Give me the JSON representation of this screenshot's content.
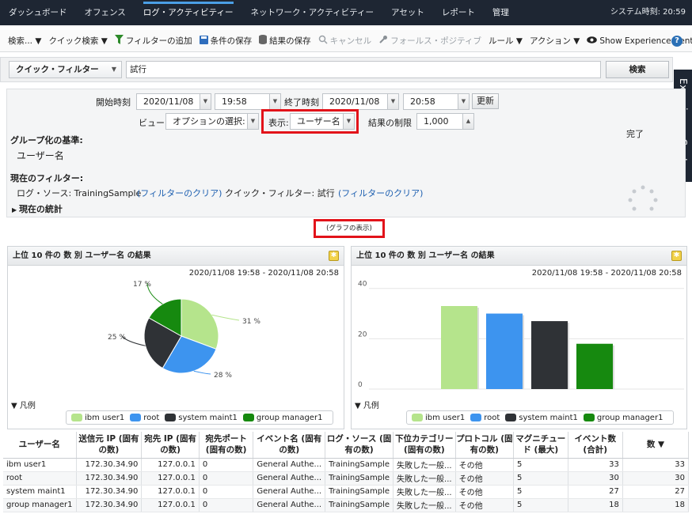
{
  "nav": {
    "items": [
      "ダッシュボード",
      "オフェンス",
      "ログ・アクティビティー",
      "ネットワーク・アクティビティー",
      "アセット",
      "レポート",
      "管理"
    ],
    "active_index": 2,
    "system_time": "システム時刻: 20:59"
  },
  "toolbar": {
    "search": "検索... ▼",
    "quick_search": "クイック検索 ▼",
    "add_filter": "フィルターの追加",
    "save_criteria": "条件の保存",
    "save_results": "結果の保存",
    "cancel": "キャンセル",
    "false_positive": "フォールス・ポジティブ",
    "rules": "ルール ▼",
    "actions": "アクション ▼",
    "experience_center": "Show Experience Center"
  },
  "quick_filter": {
    "selector": "クイック・フィルター",
    "value": "試行",
    "search_button": "検索"
  },
  "experience_tab": "Experience Center",
  "search_panel": {
    "start_label": "開始時刻",
    "start_date": "2020/11/08",
    "start_time": "19:58",
    "end_label": "終了時刻",
    "end_date": "2020/11/08",
    "end_time": "20:58",
    "update_button": "更新",
    "view_label": "ビュー:",
    "view_value": "オプションの選択:",
    "display_label": "表示:",
    "display_value": "ユーザー名",
    "limit_label": "結果の制限",
    "limit_value": "1,000",
    "status": "完了",
    "group_by_title": "グループ化の基準:",
    "group_by_value": "ユーザー名",
    "current_filter_title": "現在のフィルター:",
    "filter1": "ログ・ソース: TrainingSample",
    "clear1": "(フィルターのクリア)",
    "filter2": "クイック・フィルター: 試行",
    "clear2": "(フィルターのクリア)",
    "stats": "現在の統計"
  },
  "graph_button": "(グラフの表示)",
  "left_chart": {
    "title": "上位 10 件の 数 別 ユーザー名 の結果",
    "range": "2020/11/08 19:58 - 2020/11/08 20:58",
    "legend_title": "▼ 凡例"
  },
  "right_chart": {
    "title": "上位 10 件の 数 別 ユーザー名 の結果",
    "range": "2020/11/08 19:58 - 2020/11/08 20:58",
    "legend_title": "▼ 凡例"
  },
  "chart_data": [
    {
      "type": "pie",
      "categories": [
        "ibm user1",
        "root",
        "system maint1",
        "group manager1"
      ],
      "values": [
        31,
        28,
        25,
        17
      ],
      "labels": [
        "31 %",
        "28 %",
        "25 %",
        "17 %"
      ],
      "colors": [
        "#b5e48c",
        "#3d94ef",
        "#2f3236",
        "#16890f"
      ],
      "legend": "bottom"
    },
    {
      "type": "bar",
      "categories": [
        "ibm user1",
        "root",
        "system maint1",
        "group manager1"
      ],
      "values": [
        33,
        30,
        27,
        18
      ],
      "colors": [
        "#b5e48c",
        "#3d94ef",
        "#2f3236",
        "#16890f"
      ],
      "ylim": [
        0,
        44
      ],
      "yticks": [
        "0",
        "20",
        "40"
      ],
      "legend": "bottom"
    }
  ],
  "table": {
    "headers": [
      "ユーザー名",
      "送信元 IP (固有の数)",
      "宛先 IP (固有の数)",
      "宛先ポート (固有の数)",
      "イベント名 (固有の数)",
      "ログ・ソース (固有の数)",
      "下位カテゴリー (固有の数)",
      "プロトコル (固有の数)",
      "マグニチュード (最大)",
      "イベント数 (合計)",
      "数 ▼"
    ],
    "rows": [
      [
        "ibm user1",
        "172.30.34.90",
        "127.0.0.1",
        "0",
        "General Authe...",
        "TrainingSample",
        "失敗した一般...",
        "その他",
        "5",
        "33",
        "33"
      ],
      [
        "root",
        "172.30.34.90",
        "127.0.0.1",
        "0",
        "General Authe...",
        "TrainingSample",
        "失敗した一般...",
        "その他",
        "5",
        "30",
        "30"
      ],
      [
        "system maint1",
        "172.30.34.90",
        "127.0.0.1",
        "0",
        "General Authe...",
        "TrainingSample",
        "失敗した一般...",
        "その他",
        "5",
        "27",
        "27"
      ],
      [
        "group manager1",
        "172.30.34.90",
        "127.0.0.1",
        "0",
        "General Authe...",
        "TrainingSample",
        "失敗した一般...",
        "その他",
        "5",
        "18",
        "18"
      ]
    ]
  }
}
